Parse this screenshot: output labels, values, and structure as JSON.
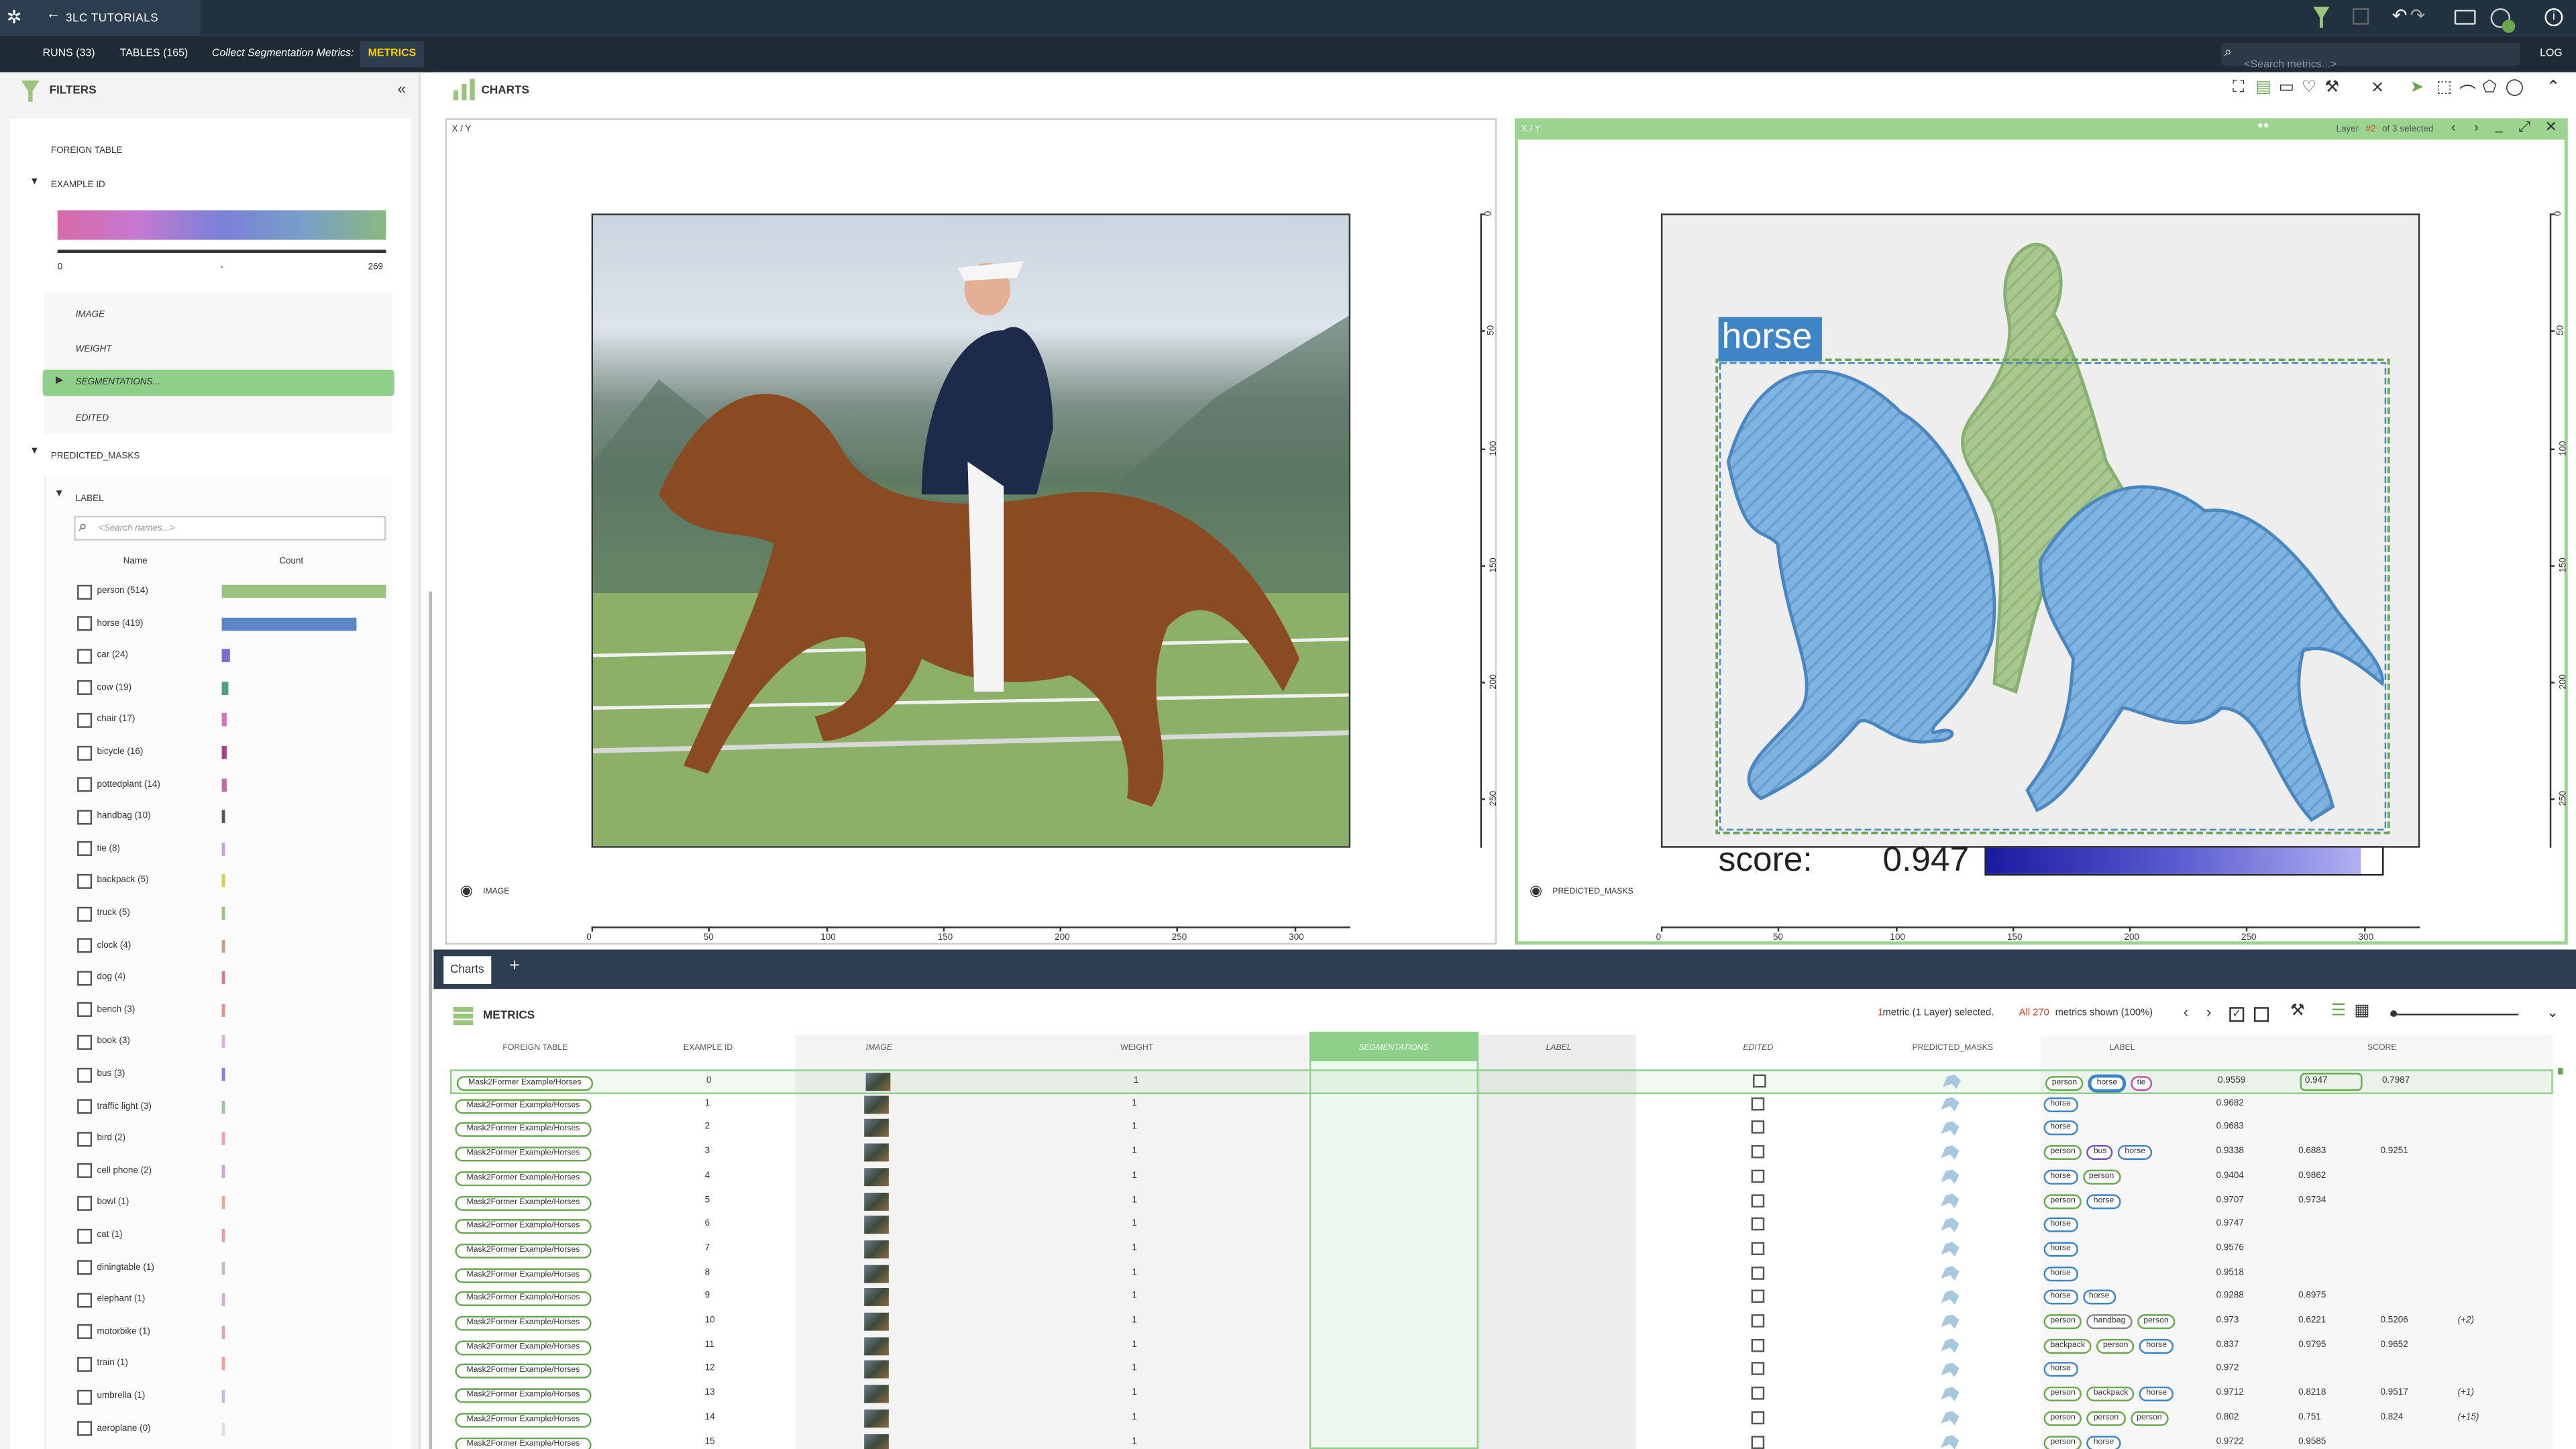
{
  "app": {
    "project_title": "3LC TUTORIALS",
    "undo_label": "↶",
    "redo_label": "↷"
  },
  "nav": {
    "runs": "RUNS (33)",
    "tables": "TABLES (165)",
    "run_action": "Collect Segmentation Metrics:",
    "metrics_tab": "METRICS",
    "search_placeholder": "<Search metrics...>",
    "log_label": "LOG"
  },
  "filters": {
    "title": "FILTERS",
    "foreign_table": "FOREIGN TABLE",
    "example_id": "EXAMPLE ID",
    "range_min": "0",
    "range_sep": "-",
    "range_max": "269",
    "image": "IMAGE",
    "weight": "WEIGHT",
    "segmentations": "SEGMENTATIONS...",
    "edited": "EDITED",
    "predicted_masks": "PREDICTED_MASKS",
    "label": "LABEL",
    "label_search_placeholder": "<Search names...>",
    "col_name": "Name",
    "col_count": "Count",
    "labels": [
      {
        "name": "person (514)",
        "count": 514,
        "color": "#9ac47e"
      },
      {
        "name": "horse (419)",
        "count": 419,
        "color": "#5b87c7"
      },
      {
        "name": "car (24)",
        "count": 24,
        "color": "#7a6ed1"
      },
      {
        "name": "cow (19)",
        "count": 19,
        "color": "#4ba08a"
      },
      {
        "name": "chair (17)",
        "count": 17,
        "color": "#d870c8"
      },
      {
        "name": "bicycle (16)",
        "count": 16,
        "color": "#b0408f"
      },
      {
        "name": "pottedplant (14)",
        "count": 14,
        "color": "#c06aa8"
      },
      {
        "name": "handbag (10)",
        "count": 10,
        "color": "#555555"
      },
      {
        "name": "tie (8)",
        "count": 8,
        "color": "#c9a0d8"
      },
      {
        "name": "backpack (5)",
        "count": 5,
        "color": "#d2d040"
      },
      {
        "name": "truck (5)",
        "count": 5,
        "color": "#9ac47e"
      },
      {
        "name": "clock (4)",
        "count": 4,
        "color": "#c8a080"
      },
      {
        "name": "dog (4)",
        "count": 4,
        "color": "#d878a0"
      },
      {
        "name": "bench (3)",
        "count": 3,
        "color": "#e09090"
      },
      {
        "name": "book (3)",
        "count": 3,
        "color": "#d8b0d8"
      },
      {
        "name": "bus (3)",
        "count": 3,
        "color": "#8080e0"
      },
      {
        "name": "traffic light (3)",
        "count": 3,
        "color": "#a0c0a0"
      },
      {
        "name": "bird (2)",
        "count": 2,
        "color": "#f0a0b0"
      },
      {
        "name": "cell phone (2)",
        "count": 2,
        "color": "#d0a0e0"
      },
      {
        "name": "bowl (1)",
        "count": 1,
        "color": "#e0b090"
      },
      {
        "name": "cat (1)",
        "count": 1,
        "color": "#e0a0a0"
      },
      {
        "name": "diningtable (1)",
        "count": 1,
        "color": "#c0c0c0"
      },
      {
        "name": "elephant (1)",
        "count": 1,
        "color": "#d0b0d0"
      },
      {
        "name": "motorbike (1)",
        "count": 1,
        "color": "#e0a0c0"
      },
      {
        "name": "train (1)",
        "count": 1,
        "color": "#f0a0a0"
      },
      {
        "name": "umbrella (1)",
        "count": 1,
        "color": "#c0c0e0"
      },
      {
        "name": "aeroplane (0)",
        "count": 0,
        "color": "#e0e0e0"
      }
    ]
  },
  "charts": {
    "title": "CHARTS",
    "left": {
      "axis_title": "X / Y",
      "footer": "IMAGE",
      "x_ticks": [
        "0",
        "50",
        "100",
        "150",
        "200",
        "250",
        "300"
      ],
      "y_ticks": [
        "0",
        "50",
        "100",
        "150",
        "200",
        "250"
      ]
    },
    "right": {
      "axis_title": "X / Y",
      "layer_prefix": "Layer",
      "layer_num": "#2",
      "layer_suffix": "of 3 selected",
      "footer": "PREDICTED_MASKS",
      "box_label": "horse",
      "score_label": "score:",
      "score_value": "0.947",
      "score_fraction": 0.947,
      "x_ticks": [
        "0",
        "50",
        "100",
        "150",
        "200",
        "250",
        "300"
      ],
      "y_ticks": [
        "0",
        "50",
        "100",
        "150",
        "200",
        "250"
      ]
    }
  },
  "tabs": {
    "charts": "Charts",
    "add": "+"
  },
  "metrics": {
    "title": "METRICS",
    "selection_count": "1",
    "selection_text": " metric (1 Layer) selected.",
    "all_shown": "All 270",
    "shown_suffix": " metrics shown (100%)",
    "columns": [
      "FOREIGN TABLE",
      "EXAMPLE ID",
      "IMAGE",
      "WEIGHT",
      "SEGMENTATIONS",
      "LABEL",
      "EDITED",
      "PREDICTED_MASKS",
      "LABEL",
      "SCORE"
    ],
    "rows": [
      {
        "ft": "Mask2Former Example/Horses",
        "id": "0",
        "w": "1",
        "labels": [
          "person",
          "horse",
          "tie"
        ],
        "scores": [
          "0.9559",
          "0.947",
          "0.7987"
        ],
        "extra": ""
      },
      {
        "ft": "Mask2Former Example/Horses",
        "id": "1",
        "w": "1",
        "labels": [
          "horse"
        ],
        "scores": [
          "0.9682"
        ],
        "extra": ""
      },
      {
        "ft": "Mask2Former Example/Horses",
        "id": "2",
        "w": "1",
        "labels": [
          "horse"
        ],
        "scores": [
          "0.9683"
        ],
        "extra": ""
      },
      {
        "ft": "Mask2Former Example/Horses",
        "id": "3",
        "w": "1",
        "labels": [
          "person",
          "bus",
          "horse"
        ],
        "scores": [
          "0.9338",
          "0.6883",
          "0.9251"
        ],
        "extra": ""
      },
      {
        "ft": "Mask2Former Example/Horses",
        "id": "4",
        "w": "1",
        "labels": [
          "horse",
          "person"
        ],
        "scores": [
          "0.9404",
          "0.9862"
        ],
        "extra": ""
      },
      {
        "ft": "Mask2Former Example/Horses",
        "id": "5",
        "w": "1",
        "labels": [
          "person",
          "horse"
        ],
        "scores": [
          "0.9707",
          "0.9734"
        ],
        "extra": ""
      },
      {
        "ft": "Mask2Former Example/Horses",
        "id": "6",
        "w": "1",
        "labels": [
          "horse"
        ],
        "scores": [
          "0.9747"
        ],
        "extra": ""
      },
      {
        "ft": "Mask2Former Example/Horses",
        "id": "7",
        "w": "1",
        "labels": [
          "horse"
        ],
        "scores": [
          "0.9576"
        ],
        "extra": ""
      },
      {
        "ft": "Mask2Former Example/Horses",
        "id": "8",
        "w": "1",
        "labels": [
          "horse"
        ],
        "scores": [
          "0.9518"
        ],
        "extra": ""
      },
      {
        "ft": "Mask2Former Example/Horses",
        "id": "9",
        "w": "1",
        "labels": [
          "horse",
          "horse"
        ],
        "scores": [
          "0.9288",
          "0.8975"
        ],
        "extra": ""
      },
      {
        "ft": "Mask2Former Example/Horses",
        "id": "10",
        "w": "1",
        "labels": [
          "person",
          "handbag",
          "person"
        ],
        "scores": [
          "0.973",
          "0.6221",
          "0.5206"
        ],
        "extra": "(+2)"
      },
      {
        "ft": "Mask2Former Example/Horses",
        "id": "11",
        "w": "1",
        "labels": [
          "backpack",
          "person",
          "horse"
        ],
        "scores": [
          "0.837",
          "0.9795",
          "0.9652"
        ],
        "extra": ""
      },
      {
        "ft": "Mask2Former Example/Horses",
        "id": "12",
        "w": "1",
        "labels": [
          "horse"
        ],
        "scores": [
          "0.972"
        ],
        "extra": ""
      },
      {
        "ft": "Mask2Former Example/Horses",
        "id": "13",
        "w": "1",
        "labels": [
          "person",
          "backpack",
          "horse"
        ],
        "scores": [
          "0.9712",
          "0.8218",
          "0.9517"
        ],
        "extra": "(+1)"
      },
      {
        "ft": "Mask2Former Example/Horses",
        "id": "14",
        "w": "1",
        "labels": [
          "person",
          "person",
          "person"
        ],
        "scores": [
          "0.802",
          "0.751",
          "0.824"
        ],
        "extra": "(+15)"
      },
      {
        "ft": "Mask2Former Example/Horses",
        "id": "15",
        "w": "1",
        "labels": [
          "person",
          "horse"
        ],
        "scores": [
          "0.9722",
          "0.9585"
        ],
        "extra": ""
      }
    ]
  }
}
